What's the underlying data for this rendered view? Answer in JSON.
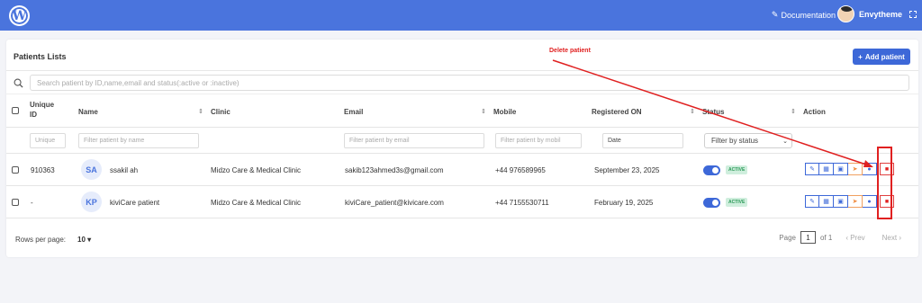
{
  "topbar": {
    "logo": "W",
    "documentation_label": "Documentation",
    "user_name": "Envytheme"
  },
  "panel": {
    "title": "Patients Lists",
    "add_button_label": "Add patient",
    "search_placeholder": "Search patient by ID,name,email and status(:active or :inactive)"
  },
  "table": {
    "headers": {
      "unique_id": "Unique ID",
      "name": "Name",
      "clinic": "Clinic",
      "email": "Email",
      "mobile": "Mobile",
      "registered_on": "Registered ON",
      "status": "Status",
      "action": "Action"
    },
    "filters": {
      "unique": "Unique",
      "name": "Filter patient by name",
      "email": "Filter patient by email",
      "mobile": "Filter patient by mobil",
      "date": "Date",
      "status": "Filter by status"
    },
    "rows": [
      {
        "id": "910363",
        "initials": "SA",
        "name": "ssakil ah",
        "clinic": "Midzo Care & Medical Clinic",
        "email": "sakib123ahmed3s@gmail.com",
        "mobile": "+44 976589965",
        "registered": "September 23, 2025",
        "status": "ACTIVE"
      },
      {
        "id": "-",
        "initials": "KP",
        "name": "kiviCare patient",
        "clinic": "Midzo Care & Medical Clinic",
        "email": "kiviCare_patient@kivicare.com",
        "mobile": "+44 7155530711",
        "registered": "February 19, 2025",
        "status": "ACTIVE"
      }
    ]
  },
  "footer": {
    "rows_per_page_label": "Rows per page:",
    "rows_per_page_value": "10",
    "page_label": "Page",
    "page_value": "1",
    "of_label": "of 1",
    "prev_label": "Prev",
    "next_label": "Next"
  },
  "annotation": {
    "text": "Delete patient",
    "color": "#e02020"
  },
  "colors": {
    "brand": "#4a74dd",
    "button": "#3d68d8",
    "active_badge": "#2c9a58"
  }
}
